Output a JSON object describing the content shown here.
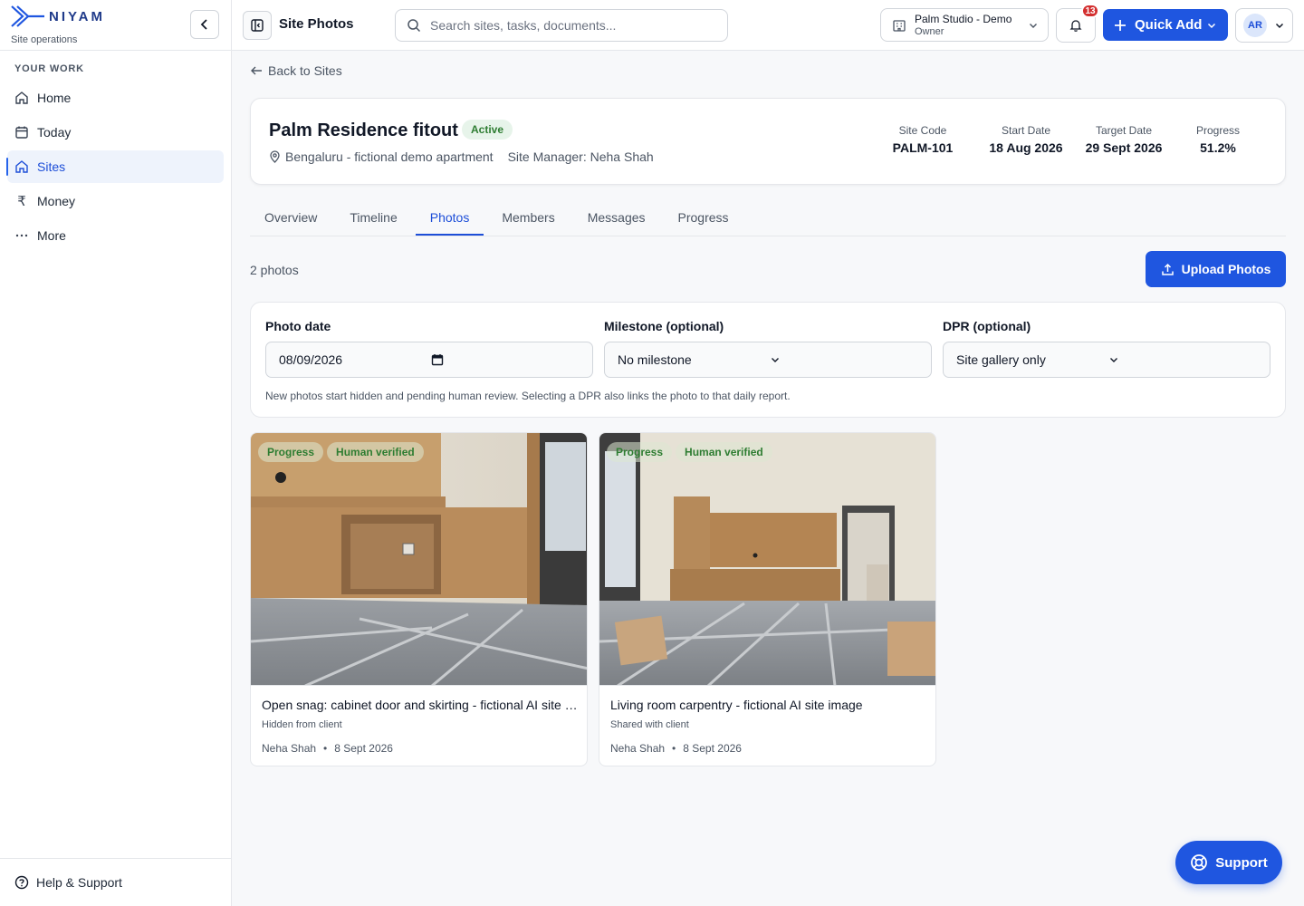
{
  "brand": {
    "name": "NIYAM",
    "tagline": "Site operations"
  },
  "sidebar": {
    "section_label": "YOUR WORK",
    "items": [
      {
        "label": "Home",
        "icon": "home-icon"
      },
      {
        "label": "Today",
        "icon": "calendar-icon"
      },
      {
        "label": "Sites",
        "icon": "home-icon",
        "active": true
      },
      {
        "label": "Money",
        "icon": "rupee-icon"
      },
      {
        "label": "More",
        "icon": "more-icon"
      }
    ],
    "footer_label": "Help & Support"
  },
  "header": {
    "title": "Site Photos",
    "search_placeholder": "Search sites, tasks, documents...",
    "workspace_name": "Palm Studio - Demo",
    "workspace_role": "Owner",
    "notification_count": "13",
    "quick_add_label": "Quick Add",
    "user_initials": "AR"
  },
  "back_link": "Back to Sites",
  "site": {
    "name": "Palm Residence fitout",
    "status": "Active",
    "location": "Bengaluru - fictional demo apartment",
    "manager": "Site Manager: Neha Shah",
    "stats": [
      {
        "label": "Site Code",
        "value": "PALM-101"
      },
      {
        "label": "Start Date",
        "value": "18 Aug 2026"
      },
      {
        "label": "Target Date",
        "value": "29 Sept 2026"
      },
      {
        "label": "Progress",
        "value": "51.2%"
      }
    ]
  },
  "tabs": [
    "Overview",
    "Timeline",
    "Photos",
    "Members",
    "Messages",
    "Progress"
  ],
  "active_tab": "Photos",
  "photos_count": "2 photos",
  "upload_label": "Upload Photos",
  "filters": {
    "date_label": "Photo date",
    "date_value": "08/09/2026",
    "milestone_label": "Milestone (optional)",
    "milestone_value": "No milestone",
    "dpr_label": "DPR (optional)",
    "dpr_value": "Site gallery only",
    "note": "New photos start hidden and pending human review. Selecting a DPR also links the photo to that daily report."
  },
  "photos": [
    {
      "tags": [
        "Progress",
        "Human verified"
      ],
      "caption": "Open snag: cabinet door and skirting - fictional AI site image",
      "visibility": "Hidden from client",
      "author": "Neha Shah",
      "date": "8 Sept 2026"
    },
    {
      "tags": [
        "Progress",
        "Human verified"
      ],
      "caption": "Living room carpentry - fictional AI site image",
      "visibility": "Shared with client",
      "author": "Neha Shah",
      "date": "8 Sept 2026"
    }
  ],
  "support_label": "Support",
  "colors": {
    "primary": "#1f56e0",
    "active_bg": "#eef3fc",
    "success": "#2e7d32",
    "danger": "#d32f2f"
  }
}
